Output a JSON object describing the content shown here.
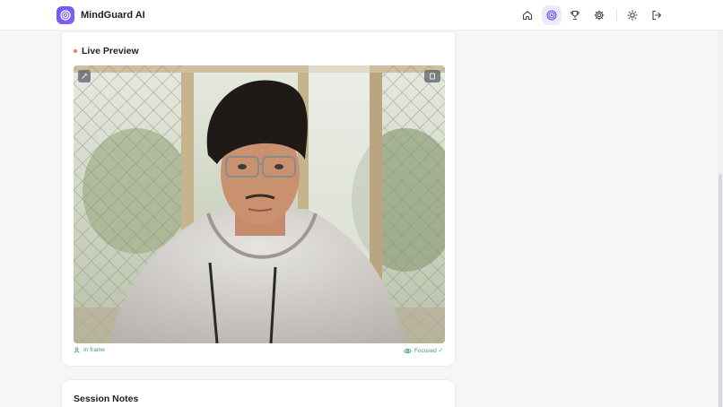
{
  "app": {
    "name": "MindGuard AI"
  },
  "nav": {
    "items": [
      {
        "name": "home",
        "active": false
      },
      {
        "name": "focus",
        "active": true
      },
      {
        "name": "achievements",
        "active": false
      },
      {
        "name": "settings",
        "active": false
      }
    ],
    "theme_icon": "sun-icon",
    "logout_icon": "logout-icon"
  },
  "preview": {
    "title": "Live Preview",
    "status_left": "In frame",
    "status_right": "Focused ✓"
  },
  "notes": {
    "title": "Session Notes"
  },
  "colors": {
    "accent": "#6a5cf0",
    "success": "#3aa45c",
    "live_dot": "#ef7a5a"
  }
}
